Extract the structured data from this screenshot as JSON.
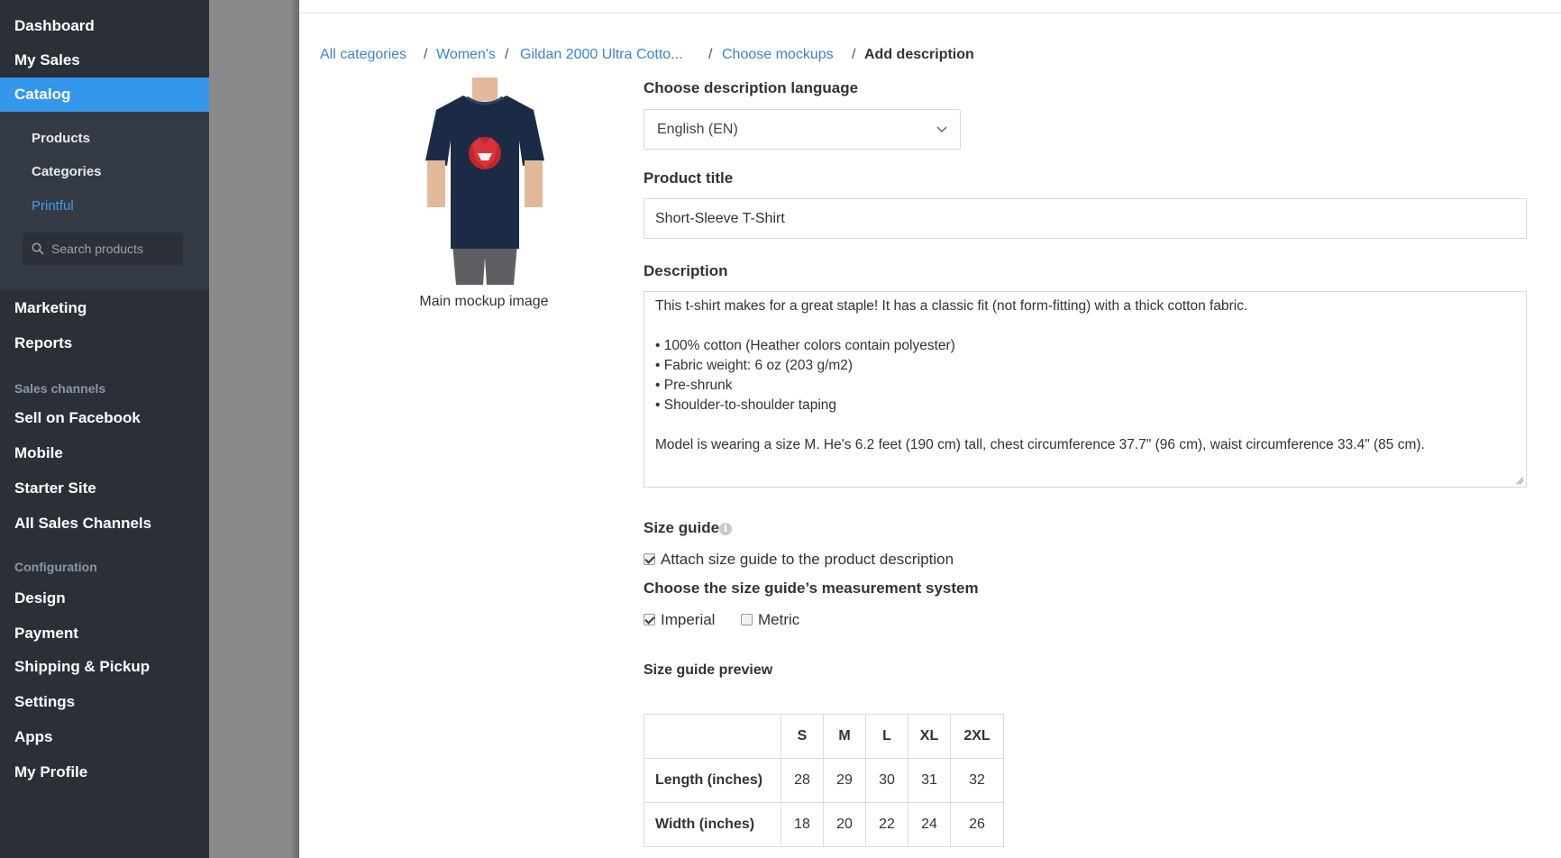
{
  "sidebar": {
    "top_items": [
      "Dashboard",
      "My Sales"
    ],
    "active_item": "Catalog",
    "sub_items": [
      "Products",
      "Categories"
    ],
    "sub_active": "Printful",
    "search_placeholder": "Search products",
    "mid_items": [
      "Marketing",
      "Reports"
    ],
    "sales_channels_label": "Sales channels",
    "sales_channels": [
      "Sell on Facebook",
      "Mobile",
      "Starter Site",
      "All Sales Channels"
    ],
    "configuration_label": "Configuration",
    "configuration_items": [
      "Design",
      "Payment",
      "Shipping & Pickup",
      "Settings",
      "Apps",
      "My Profile"
    ]
  },
  "breadcrumb": {
    "items": [
      "All categories",
      "Women's",
      "Gildan 2000 Ultra Cotto...",
      "Choose mockups"
    ],
    "separator": "/",
    "current": "Add description"
  },
  "mockup": {
    "caption": "Main mockup image",
    "shirt_color": "#1c2b45"
  },
  "form": {
    "language_label": "Choose description language",
    "language_value": "English (EN)",
    "title_label": "Product title",
    "title_value": "Short-Sleeve T-Shirt",
    "description_label": "Description",
    "description_lines": [
      "This t-shirt makes for a great staple! It has a classic fit (not form-fitting) with a thick cotton fabric.",
      "",
      "• 100% cotton (Heather colors contain polyester)",
      "• Fabric weight: 6 oz (203 g/m2)",
      "• Pre-shrunk",
      "• Shoulder-to-shoulder taping",
      "",
      "Model is wearing a size M. He's 6.2 feet (190 cm) tall, chest circumference 37.7\" (96 cm), waist circumference 33.4\" (85 cm)."
    ],
    "size_guide_label": "Size guide",
    "size_guide_info_icon": "i",
    "attach_label": "Attach size guide to the product description",
    "attach_checked": true,
    "measurement_label": "Choose the size guide’s measurement system",
    "imperial_label": "Imperial",
    "imperial_checked": true,
    "metric_label": "Metric",
    "metric_checked": false,
    "preview_label": "Size guide preview"
  },
  "size_table": {
    "columns": [
      "S",
      "M",
      "L",
      "XL",
      "2XL"
    ],
    "rows": [
      {
        "label": "Length (inches)",
        "values": [
          "28",
          "29",
          "30",
          "31",
          "32"
        ]
      },
      {
        "label": "Width (inches)",
        "values": [
          "18",
          "20",
          "22",
          "24",
          "26"
        ]
      }
    ]
  },
  "colors": {
    "sidebar_bg": "#2b3038",
    "sidebar_active": "#3597ec",
    "link": "#3a86c8"
  }
}
